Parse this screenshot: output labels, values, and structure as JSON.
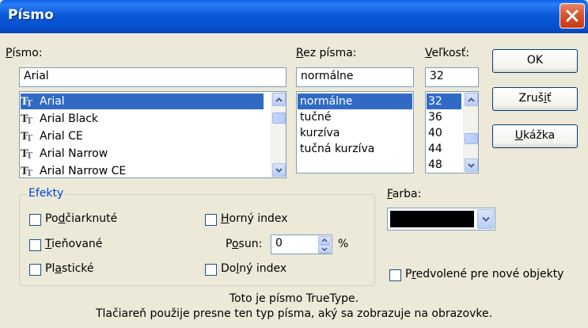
{
  "window": {
    "title": "Písmo"
  },
  "font_label": {
    "pre": "",
    "key": "P",
    "post": "ísmo:"
  },
  "font_input_value": "Arial",
  "font_list": [
    "Arial",
    "Arial Black",
    "Arial CE",
    "Arial Narrow",
    "Arial Narrow CE"
  ],
  "style_label": {
    "pre": "",
    "key": "R",
    "post": "ez písma:"
  },
  "style_input_value": "normálne",
  "style_list": [
    "normálne",
    "tučné",
    "kurzíva",
    "tučná kurzíva"
  ],
  "size_label": {
    "pre": "",
    "key": "V",
    "post": "eľkosť:"
  },
  "size_input_value": "32",
  "size_list": [
    "32",
    "36",
    "40",
    "44",
    "48"
  ],
  "buttons": {
    "ok": "OK",
    "cancel": {
      "pre": "Zruš",
      "key": "i",
      "post": "ť"
    },
    "preview": {
      "pre": "",
      "key": "U",
      "post": "kážka"
    }
  },
  "effects": {
    "title": "Efekty",
    "underline": {
      "pre": "Po",
      "key": "d",
      "post": "čiarknuté"
    },
    "shadow": {
      "pre": "",
      "key": "T",
      "post": "ieňované"
    },
    "emboss": {
      "pre": "Pl",
      "key": "a",
      "post": "stické"
    },
    "superscript": {
      "pre": "",
      "key": "H",
      "post": "orný index"
    },
    "offset_label": {
      "pre": "P",
      "key": "o",
      "post": "sun:"
    },
    "offset_value": "0",
    "offset_unit": "%",
    "subscript": {
      "pre": "Do",
      "key": "l",
      "post": "ný index"
    }
  },
  "color": {
    "label": {
      "pre": "",
      "key": "F",
      "post": "arba:"
    },
    "value": "#000000"
  },
  "default_checkbox": {
    "pre": "P",
    "key": "r",
    "post": "edvolené pre nové objekty"
  },
  "info_line1": "Toto je písmo TrueType.",
  "info_line2": "Tlačiareň použije presne ten typ písma, aký sa zobrazuje na obrazovke.",
  "colors": {
    "title_bar": "#0a5fe6",
    "selection": "#316ac5",
    "effects_title": "#0046d5",
    "dialog_bg": "#ece9d8"
  }
}
